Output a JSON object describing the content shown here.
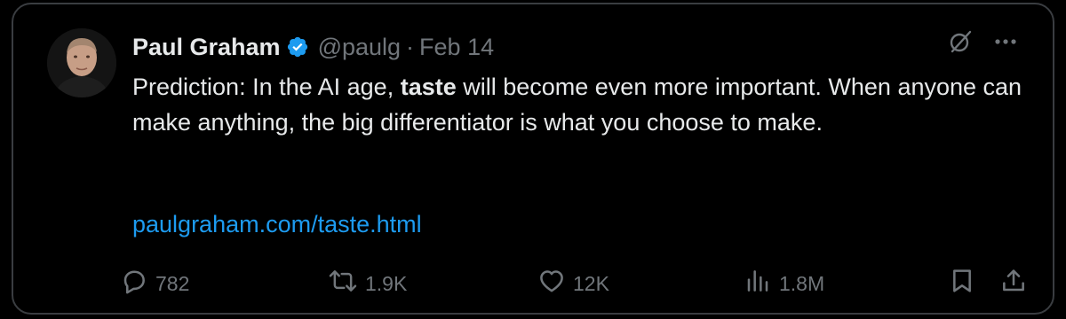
{
  "tweet": {
    "author_name": "Paul Graham",
    "handle": "@paulg",
    "separator": "·",
    "date": "Feb 14",
    "text_before": "Prediction: In the AI age, ",
    "text_bold": "taste",
    "text_after": " will become even more important. When anyone can make anything, the big differentiator is what you choose to make.",
    "link": "paulgraham.com/taste.html"
  },
  "header_icons": [
    "grok-icon",
    "more-icon"
  ],
  "actions": {
    "replies": "782",
    "reposts": "1.9K",
    "likes": "12K",
    "views": "1.8M"
  },
  "colors": {
    "background": "#000000",
    "text": "#e7e9ea",
    "muted": "#71767b",
    "link": "#1d9bf0",
    "verified": "#1d9bf0",
    "border": "#3a3d41"
  }
}
